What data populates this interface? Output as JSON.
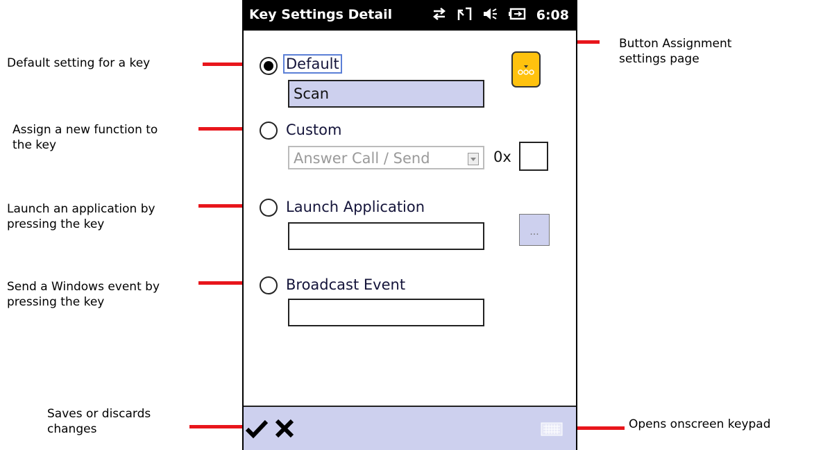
{
  "annotations": {
    "default_setting": "Default setting for a key",
    "assign_function": "Assign a new function to\nthe key",
    "launch_app": "Launch an application by\npressing the key",
    "send_event": "Send a Windows event by\npressing the key",
    "button_assignment": "Button Assignment\nsettings page",
    "saves_discards": "Saves or discards\nchanges",
    "onscreen_keypad": "Opens onscreen keypad"
  },
  "titlebar": {
    "title": "Key Settings Detail",
    "time": "6:08",
    "icons": [
      "connectivity-icon",
      "signal-icon",
      "volume-icon",
      "battery-icon"
    ]
  },
  "options": {
    "default": {
      "label": "Default",
      "value": "Scan",
      "selected": true
    },
    "custom": {
      "label": "Custom",
      "combo_value": "Answer Call / Send",
      "hex_prefix": "0x",
      "hex_value": ""
    },
    "launch": {
      "label": "Launch Application",
      "value": "",
      "browse_label": "..."
    },
    "broadcast": {
      "label": "Broadcast Event",
      "value": ""
    }
  },
  "colors": {
    "annotation_red": "#e8161c",
    "selected_field": "#cdd0ee",
    "menu_button": "#ffc20e"
  }
}
